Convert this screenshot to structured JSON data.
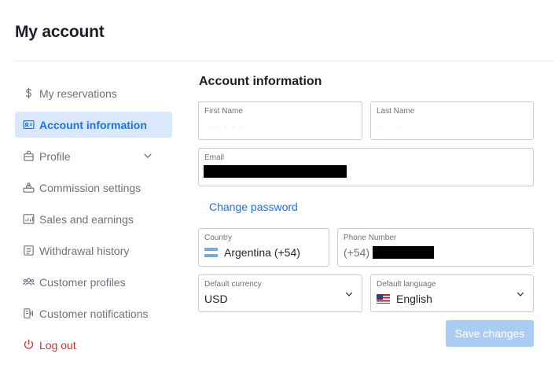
{
  "page": {
    "title": "My account"
  },
  "sidebar": {
    "items": [
      {
        "label": "My reservations",
        "icon": "dollar-icon"
      },
      {
        "label": "Account information",
        "icon": "id-card-icon",
        "active": true
      },
      {
        "label": "Profile",
        "icon": "bag-icon",
        "expandable": true
      },
      {
        "label": "Commission settings",
        "icon": "commission-icon"
      },
      {
        "label": "Sales and earnings",
        "icon": "chart-icon"
      },
      {
        "label": "Withdrawal history",
        "icon": "wallet-icon"
      },
      {
        "label": "Customer profiles",
        "icon": "users-icon"
      },
      {
        "label": "Customer notifications",
        "icon": "bell-icon"
      },
      {
        "label": "Log out",
        "icon": "power-icon"
      }
    ]
  },
  "main": {
    "title": "Account information",
    "first_name": {
      "label": "First Name"
    },
    "last_name": {
      "label": "Last Name"
    },
    "email": {
      "label": "Email"
    },
    "change_password": "Change password",
    "country": {
      "label": "Country",
      "value": "Argentina (+54)",
      "flag": "argentina-flag"
    },
    "phone": {
      "label": "Phone Number",
      "prefix": "(+54)"
    },
    "currency": {
      "label": "Default currency",
      "value": "USD"
    },
    "language": {
      "label": "Default language",
      "value": "English",
      "flag": "us-flag"
    },
    "save_label": "Save changes"
  },
  "colors": {
    "accent": "#1a73e8",
    "active_bg": "#d9e9fb",
    "logout": "#d0312d",
    "save_disabled": "#a9cdf3"
  }
}
